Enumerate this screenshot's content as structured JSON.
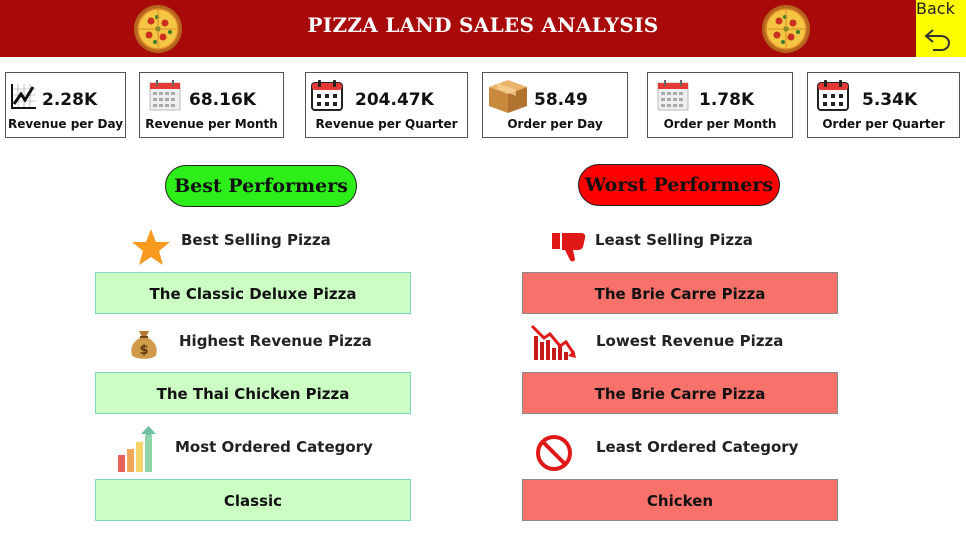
{
  "header": {
    "title": "PIZZA LAND SALES ANALYSIS",
    "back_label": "Back",
    "colors": {
      "header_bg": "#a80a0a",
      "back_bg": "#ffff00"
    }
  },
  "kpis": [
    {
      "value": "2.28K",
      "label": "Revenue per Day",
      "icon": "line-chart-icon"
    },
    {
      "value": "68.16K",
      "label": "Revenue per Month",
      "icon": "calendar-month-icon"
    },
    {
      "value": "204.47K",
      "label": "Revenue per Quarter",
      "icon": "calendar-quarter-icon"
    },
    {
      "value": "58.49",
      "label": "Order per Day",
      "icon": "box-icon"
    },
    {
      "value": "1.78K",
      "label": "Order per Month",
      "icon": "calendar-month-icon"
    },
    {
      "value": "5.34K",
      "label": "Order per Quarter",
      "icon": "calendar-quarter-icon"
    }
  ],
  "best": {
    "title": "Best Performers",
    "color": "#2dee19",
    "sections": [
      {
        "label": "Best Selling Pizza",
        "value": "The Classic Deluxe Pizza",
        "icon": "star-icon"
      },
      {
        "label": "Highest Revenue Pizza",
        "value": "The Thai Chicken Pizza",
        "icon": "money-bag-icon"
      },
      {
        "label": "Most Ordered Category",
        "value": "Classic",
        "icon": "bar-growth-icon"
      }
    ]
  },
  "worst": {
    "title": "Worst Performers",
    "color": "#ff0000",
    "sections": [
      {
        "label": "Least Selling Pizza",
        "value": "The Brie Carre Pizza",
        "icon": "thumbs-down-icon"
      },
      {
        "label": "Lowest Revenue Pizza",
        "value": "The Brie Carre Pizza",
        "icon": "decline-chart-icon"
      },
      {
        "label": "Least Ordered Category",
        "value": "Chicken",
        "icon": "prohibited-icon"
      }
    ]
  }
}
